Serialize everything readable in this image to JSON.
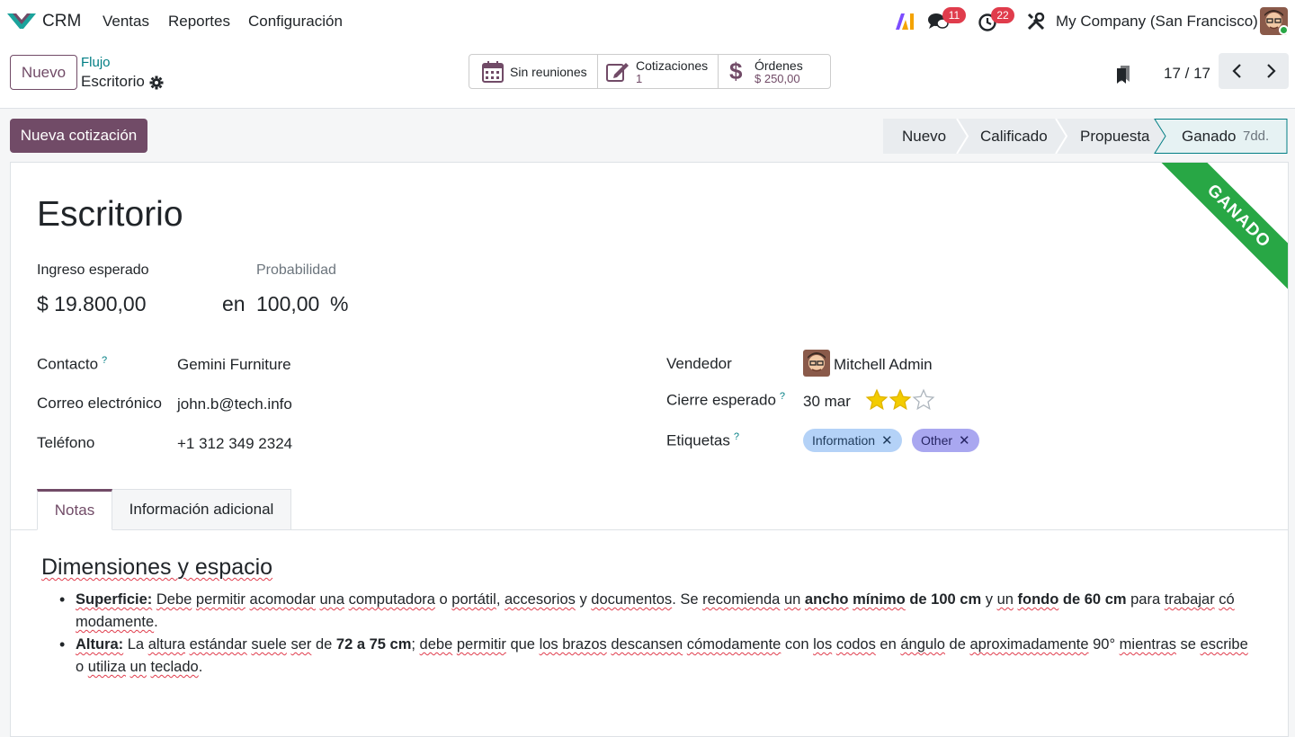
{
  "navbar": {
    "app_name": "CRM",
    "menu": [
      "Ventas",
      "Reportes",
      "Configuración"
    ],
    "messages_count": "11",
    "activities_count": "22",
    "company": "My Company (San Francisco)"
  },
  "control": {
    "new_label": "Nuevo",
    "breadcrumb_parent": "Flujo",
    "breadcrumb_current": "Escritorio",
    "smart_buttons": {
      "meetings_label": "Sin reuniones",
      "quotations_label": "Cotizaciones",
      "quotations_value": "1",
      "orders_label": "Órdenes",
      "orders_value": "$ 250,00"
    },
    "pager": "17 / 17"
  },
  "statusbar": {
    "new_quote_label": "Nueva cotización",
    "stages": [
      "Nuevo",
      "Calificado",
      "Propuesta",
      "Ganado"
    ],
    "active_stage_duration": "7dd."
  },
  "record": {
    "ribbon": "GANADO",
    "title": "Escritorio",
    "expected_revenue_label": "Ingreso esperado",
    "expected_revenue": "$ 19.800,00",
    "probability_label": "Probabilidad",
    "probability_prefix": "en",
    "probability": "100,00",
    "probability_unit": "%",
    "contact_label": "Contacto",
    "contact": "Gemini Furniture",
    "email_label": "Correo electrónico",
    "email": "john.b@tech.info",
    "phone_label": "Teléfono",
    "phone": "+1 312 349 2324",
    "salesperson_label": "Vendedor",
    "salesperson": "Mitchell Admin",
    "closing_label": "Cierre esperado",
    "closing": "30 mar",
    "priority_stars": 2,
    "priority_max": 3,
    "tags_label": "Etiquetas",
    "tags": [
      "Information",
      "Other"
    ],
    "help_mark": "?"
  },
  "tabs": [
    "Notas",
    "Información adicional"
  ],
  "notes": {
    "heading": "Dimensiones y espacio",
    "item1_title": "Superficie:",
    "item2_title": "Altura:"
  },
  "colors": {
    "brand": "#714b67",
    "link": "#017e84",
    "won": "#28a745",
    "badge": "#e03c4c",
    "tag_information": "#b4d2f7",
    "tag_other": "#a9a7f0"
  }
}
